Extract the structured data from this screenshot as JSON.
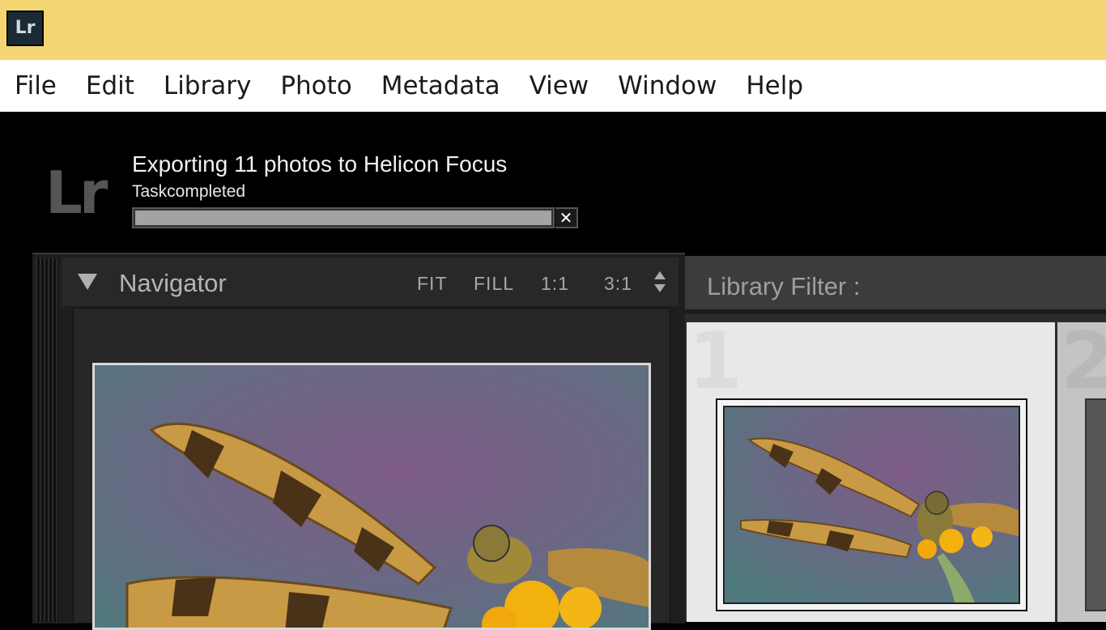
{
  "window": {
    "app_icon_text": "Lr",
    "accent_color": "#f3d572"
  },
  "menubar": {
    "items": [
      "File",
      "Edit",
      "Library",
      "Photo",
      "Metadata",
      "View",
      "Window",
      "Help"
    ]
  },
  "task": {
    "logo_text": "Lr",
    "title": "Exporting 11 photos to Helicon Focus",
    "status": "Taskcompleted",
    "progress_percent": 100,
    "cancel_icon": "close-icon"
  },
  "navigator": {
    "title": "Navigator",
    "zoom_options": [
      "FIT",
      "FILL",
      "1:1",
      "3:1"
    ],
    "collapse_icon": "triangle-down-icon",
    "zoom_stepper_icon": "up-down-arrows-icon"
  },
  "library_filter": {
    "label": "Library Filter :"
  },
  "grid": {
    "cells": [
      {
        "index": "1"
      },
      {
        "index": "2"
      }
    ]
  }
}
